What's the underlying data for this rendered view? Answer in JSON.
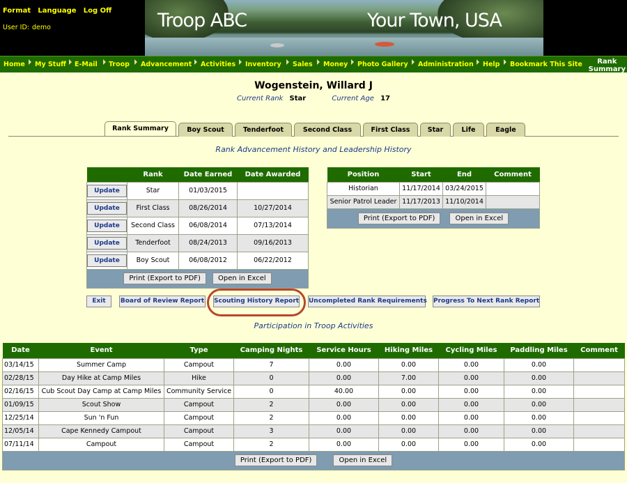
{
  "header": {
    "links": [
      "Format",
      "Language",
      "Log Off"
    ],
    "user_label": "User ID:",
    "user_id": "demo",
    "troop": "Troop ABC",
    "town": "Your Town, USA"
  },
  "nav": {
    "items": [
      "Home",
      "My Stuff",
      "E-Mail",
      "Troop",
      "Advancement",
      "Activities",
      "Inventory",
      "Sales",
      "Money",
      "Photo Gallery",
      "Administration",
      "Help",
      "Bookmark This Site"
    ],
    "page_title_line1": "Rank",
    "page_title_line2": "Summary"
  },
  "scout": {
    "name": "Wogenstein, Willard J",
    "current_rank_label": "Current Rank",
    "current_rank": "Star",
    "current_age_label": "Current Age",
    "current_age": "17"
  },
  "tabs": [
    "Rank Summary",
    "Boy Scout",
    "Tenderfoot",
    "Second Class",
    "First Class",
    "Star",
    "Life",
    "Eagle"
  ],
  "rank_history_title": "Rank Advancement History and Leadership History",
  "rank_table": {
    "headers": [
      "",
      "Rank",
      "Date Earned",
      "Date Awarded"
    ],
    "update_label": "Update",
    "rows": [
      {
        "rank": "Star",
        "earned": "01/03/2015",
        "awarded": ""
      },
      {
        "rank": "First Class",
        "earned": "08/26/2014",
        "awarded": "10/27/2014"
      },
      {
        "rank": "Second Class",
        "earned": "06/08/2014",
        "awarded": "07/13/2014"
      },
      {
        "rank": "Tenderfoot",
        "earned": "08/24/2013",
        "awarded": "09/16/2013"
      },
      {
        "rank": "Boy Scout",
        "earned": "06/08/2012",
        "awarded": "06/22/2012"
      }
    ],
    "print_label": "Print (Export to PDF)",
    "excel_label": "Open in Excel"
  },
  "leadership_table": {
    "headers": [
      "Position",
      "Start",
      "End",
      "Comment"
    ],
    "rows": [
      {
        "position": "Historian",
        "start": "11/17/2014",
        "end": "03/24/2015",
        "comment": ""
      },
      {
        "position": "Senior Patrol Leader",
        "start": "11/17/2013",
        "end": "11/10/2014",
        "comment": ""
      }
    ],
    "print_label": "Print (Export to PDF)",
    "excel_label": "Open in Excel"
  },
  "reports": {
    "exit": "Exit",
    "board_of_review": "Board of Review Report",
    "scouting_history": "Scouting History Report",
    "uncompleted": "Uncompleted Rank Requirements",
    "progress": "Progress To Next Rank Report"
  },
  "participation_title": "Participation in Troop Activities",
  "participation_table": {
    "headers": [
      "Date",
      "Event",
      "Type",
      "Camping Nights",
      "Service Hours",
      "Hiking Miles",
      "Cycling Miles",
      "Paddling Miles",
      "Comment"
    ],
    "rows": [
      [
        "03/14/15",
        "Summer Camp",
        "Campout",
        "7",
        "0.00",
        "0.00",
        "0.00",
        "0.00",
        ""
      ],
      [
        "02/28/15",
        "Day Hike at Camp Miles",
        "Hike",
        "0",
        "0.00",
        "7.00",
        "0.00",
        "0.00",
        ""
      ],
      [
        "02/16/15",
        "Cub Scout Day Camp at Camp Miles",
        "Community Service",
        "0",
        "40.00",
        "0.00",
        "0.00",
        "0.00",
        ""
      ],
      [
        "01/09/15",
        "Scout Show",
        "Campout",
        "2",
        "0.00",
        "0.00",
        "0.00",
        "0.00",
        ""
      ],
      [
        "12/25/14",
        "Sun 'n Fun",
        "Campout",
        "2",
        "0.00",
        "0.00",
        "0.00",
        "0.00",
        ""
      ],
      [
        "12/05/14",
        "Cape Kennedy Campout",
        "Campout",
        "3",
        "0.00",
        "0.00",
        "0.00",
        "0.00",
        ""
      ],
      [
        "07/11/14",
        "Campout",
        "Campout",
        "2",
        "0.00",
        "0.00",
        "0.00",
        "0.00",
        ""
      ]
    ],
    "print_label": "Print (Export to PDF)",
    "excel_label": "Open in Excel"
  }
}
